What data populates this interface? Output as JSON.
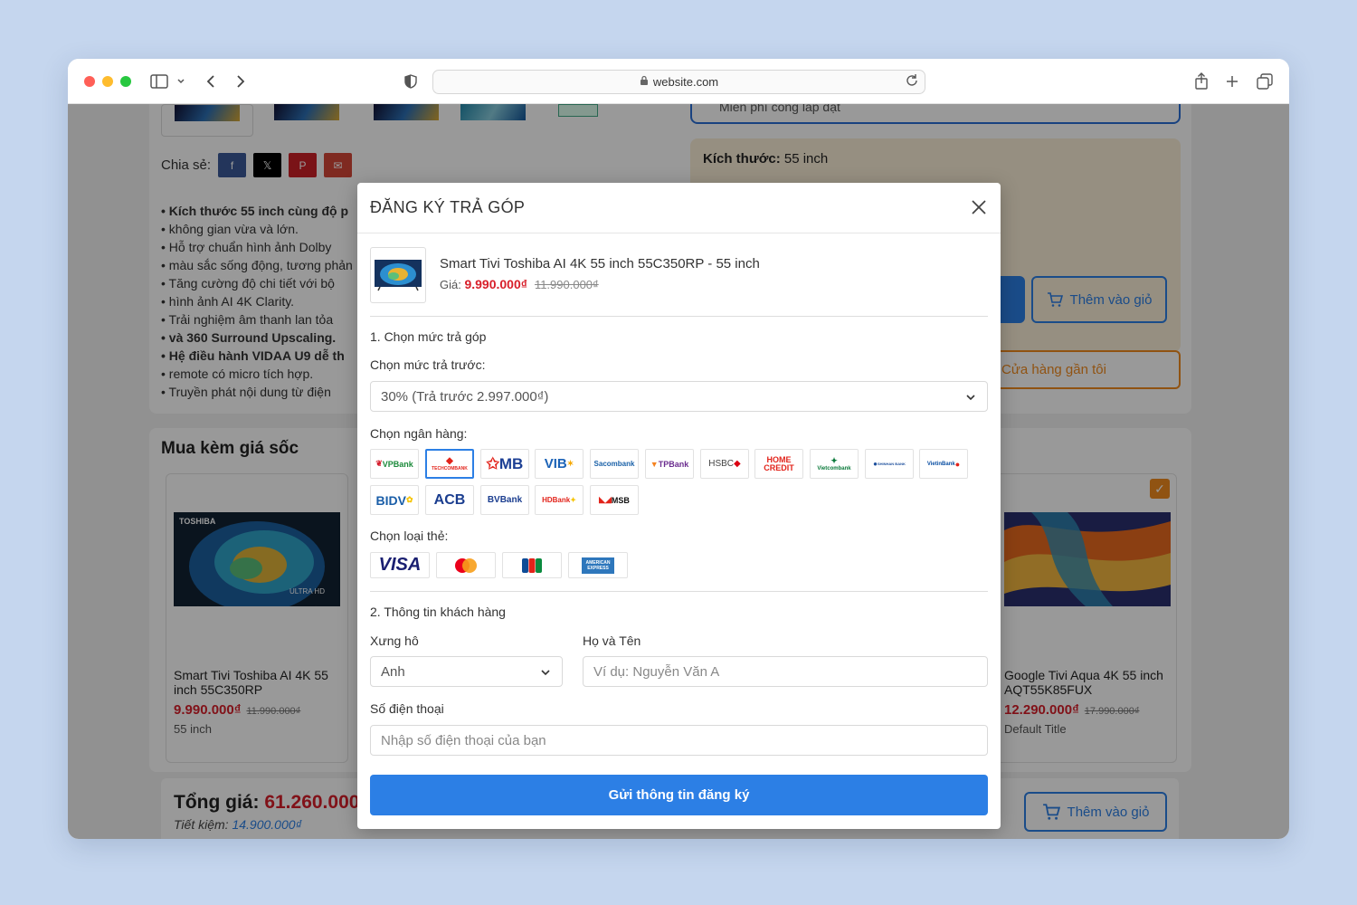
{
  "browser": {
    "url": "website.com"
  },
  "background_page": {
    "share_label": "Chia sẻ:",
    "bullets": [
      "Kích thước 55 inch cùng độ p",
      "không gian vừa và lớn.",
      "Hỗ trợ chuẩn hình ảnh Dolby",
      "màu sắc sống động, tương phản",
      "Tăng cường độ chi tiết với bộ",
      "hình ảnh AI 4K Clarity.",
      "Trải nghiệm âm thanh lan tỏa",
      "và 360 Surround Upscaling.",
      "Hệ điều hành VIDAA U9 dễ th",
      "remote có micro tích hợp.",
      "Truyền phát nội dung từ điện"
    ],
    "install_note": "Miễn phí công lắp đặt",
    "size_label": "Kích thước:",
    "size_value": "55 inch",
    "add_to_cart": "Thêm vào giỏ",
    "nearest_store": "Cửa hàng gần tôi",
    "combo_title": "Mua kèm giá sốc",
    "products": [
      {
        "name": "Smart Tivi Toshiba AI 4K 55 inch 55C350RP",
        "price": "9.990.000₫",
        "old_price": "11.990.000₫",
        "variant": "55 inch",
        "brand_text": "TOSHIBA",
        "badge_text": "ULTRA HD"
      },
      {
        "name": "Google Tivi Aqua 4K 55 inch AQT55K85FUX",
        "price": "12.290.000₫",
        "old_price": "17.990.000₫",
        "variant": "Default Title"
      }
    ],
    "total_label": "Tổng giá:",
    "total_value": "61.260.000",
    "saving_label": "Tiết kiệm:",
    "saving_value": "14.900.000₫",
    "add_to_cart_bottom": "Thêm vào giỏ"
  },
  "modal": {
    "title": "ĐĂNG KÝ TRẢ GÓP",
    "product": {
      "name": "Smart Tivi Toshiba AI 4K 55 inch 55C350RP - 55 inch",
      "price_label": "Giá:",
      "price": "9.990.000₫",
      "old_price": "11.990.000₫"
    },
    "step1_title": "1. Chọn mức trả góp",
    "prepay_label": "Chọn mức trả trước:",
    "prepay_value": "30% (Trả trước 2.997.000₫)",
    "bank_label": "Chọn ngân hàng:",
    "banks": [
      "VPBank",
      "TECHCOMBANK",
      "MB",
      "VIB",
      "Sacombank",
      "TPBank",
      "HSBC",
      "HOME CREDIT",
      "Vietcombank",
      "SHINHAN BANK",
      "VietinBank",
      "BIDV",
      "ACB",
      "BVBank",
      "HDBank",
      "MSB"
    ],
    "selected_bank": "TECHCOMBANK",
    "card_label": "Chọn loại thẻ:",
    "cards": [
      "VISA",
      "Mastercard",
      "JCB",
      "AMERICAN EXPRESS"
    ],
    "step2_title": "2. Thông tin khách hàng",
    "salutation_label": "Xưng hô",
    "salutation_value": "Anh",
    "name_label": "Họ và Tên",
    "name_placeholder": "Ví dụ: Nguyễn Văn A",
    "phone_label": "Số điện thoại",
    "phone_placeholder": "Nhập số điện thoại của bạn",
    "submit_label": "Gửi thông tin đăng ký"
  },
  "colors": {
    "accent": "#2c7fe5",
    "price_red": "#d81f2a",
    "orange": "#f18a1f"
  }
}
